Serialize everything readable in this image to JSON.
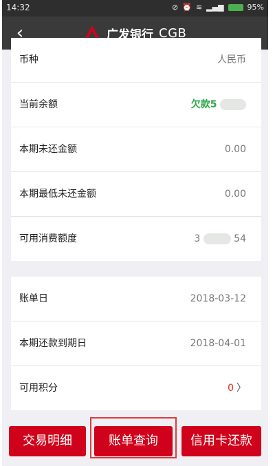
{
  "status_bar": {
    "time": "14:32",
    "battery": "95%"
  },
  "header": {
    "back_icon": "back-arrow-icon",
    "bank_name": "广发银行",
    "bank_en": "CGB",
    "accent_color": "#d0021b"
  },
  "account": {
    "rows": [
      {
        "label": "币种",
        "value": "人民币"
      },
      {
        "label": "当前余额",
        "value": "欠款5"
      },
      {
        "label": "本期未还金额",
        "value": "0.00"
      },
      {
        "label": "本期最低未还金额",
        "value": "0.00"
      },
      {
        "label": "可用消费额度",
        "value_prefix": "3",
        "value_suffix": "54"
      }
    ]
  },
  "billing": {
    "rows": [
      {
        "label": "账单日",
        "value": "2018-03-12"
      },
      {
        "label": "本期还款到期日",
        "value": "2018-04-01"
      },
      {
        "label": "可用积分",
        "value": "0"
      }
    ]
  },
  "bottom_actions": [
    {
      "label": "交易明细"
    },
    {
      "label": "账单查询"
    },
    {
      "label": "信用卡还款"
    }
  ]
}
